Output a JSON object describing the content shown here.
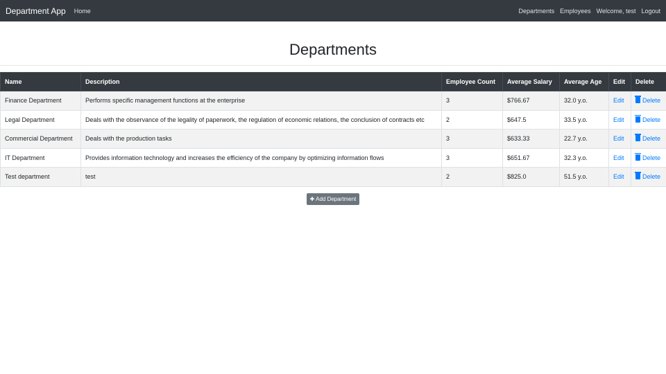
{
  "nav": {
    "brand": "Department App",
    "home": "Home",
    "departments": "Departments",
    "employees": "Employees",
    "welcome": "Welcome, test",
    "logout": "Logout"
  },
  "page_title": "Departments",
  "table": {
    "headers": [
      "Name",
      "Description",
      "Employee Count",
      "Average Salary",
      "Average Age",
      "Edit",
      "Delete"
    ],
    "rows": [
      [
        "Finance Department",
        "Performs specific management functions at the enterprise",
        "3",
        "$766.67",
        "32.0 y.o.",
        "Edit",
        "Delete"
      ],
      [
        "Legal Department",
        "Deals with the observance of the legality of paperwork, the regulation of economic relations, the conclusion of contracts etc",
        "2",
        "$647.5",
        "33.5 y.o.",
        "Edit",
        "Delete"
      ],
      [
        "Commercial Department",
        "Deals with the production tasks",
        "3",
        "$633.33",
        "22.7 y.o.",
        "Edit",
        "Delete"
      ],
      [
        "IT Department",
        "Provides information technology and increases the efficiency of the company by optimizing information flows",
        "3",
        "$651.67",
        "32.3 y.o.",
        "Edit",
        "Delete"
      ],
      [
        "Test department",
        "test",
        "2",
        "$825.0",
        "51.5 y.o.",
        "Edit",
        "Delete"
      ]
    ]
  },
  "add_button": "Add Department"
}
